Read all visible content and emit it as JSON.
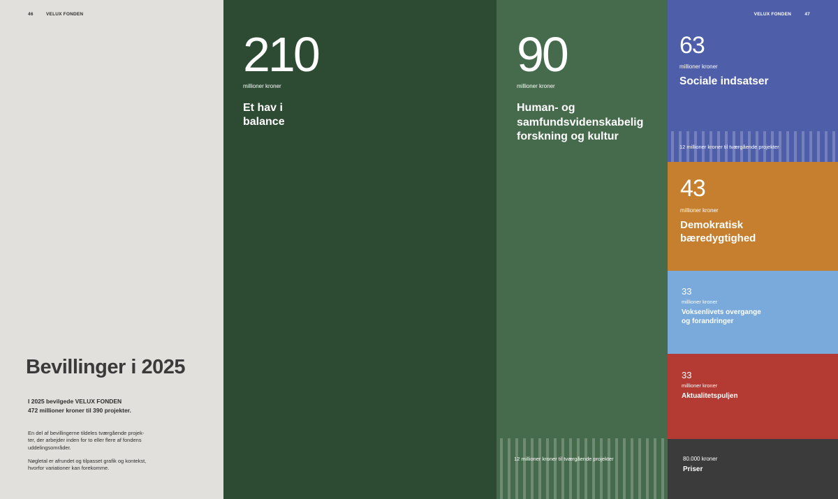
{
  "left_page": {
    "page_number": "46",
    "brand": "VELUX FONDEN",
    "title": "Bevillinger i 2025",
    "intro": "I 2025 bevilgede VELUX FONDEN\n472 millioner kroner til 390 projekter.",
    "note_1": "En del af bevillingerne tildeles tværgående projek-\nter, der arbejder inden for to eller flere af fondens\nuddelingsområder.",
    "note_2": "Nøgletal er afrundet og tilpasset grafik og kontekst,\nhvorfor variationer kan forekomme.",
    "background": "#e1e0dc"
  },
  "right_page": {
    "page_number": "47",
    "brand": "VELUX FONDEN"
  },
  "allocations": [
    {
      "amount": "210",
      "unit": "millioner kroner",
      "category": "Et hav i\nbalance",
      "color": "#2d4a33"
    },
    {
      "amount": "90",
      "unit": "millioner kroner",
      "category": "Human- og\nsamfundsvidenskabelig\nforskning og kultur",
      "color": "#466b4c",
      "cross_label": "12 millioner kroner til tværgående projekter"
    },
    {
      "amount": "63",
      "unit": "millioner kroner",
      "category": "Sociale indsatser",
      "color": "#4e5ea9",
      "cross_label": "12 millioner kroner til tværgående projekter"
    },
    {
      "amount": "43",
      "unit": "millioner kroner",
      "category": "Demokratisk\nbæredygtighed",
      "color": "#c57f2e"
    },
    {
      "amount": "33",
      "unit": "millioner kroner",
      "category": "Voksenlivets overgange\nog forandringer",
      "color": "#7aaadb"
    },
    {
      "amount": "33",
      "unit": "millioner kroner",
      "category": "Aktualitetspuljen",
      "color": "#b33b33"
    },
    {
      "amount_text": "80.000 kroner",
      "category": "Priser",
      "color": "#3b3b3b"
    }
  ]
}
